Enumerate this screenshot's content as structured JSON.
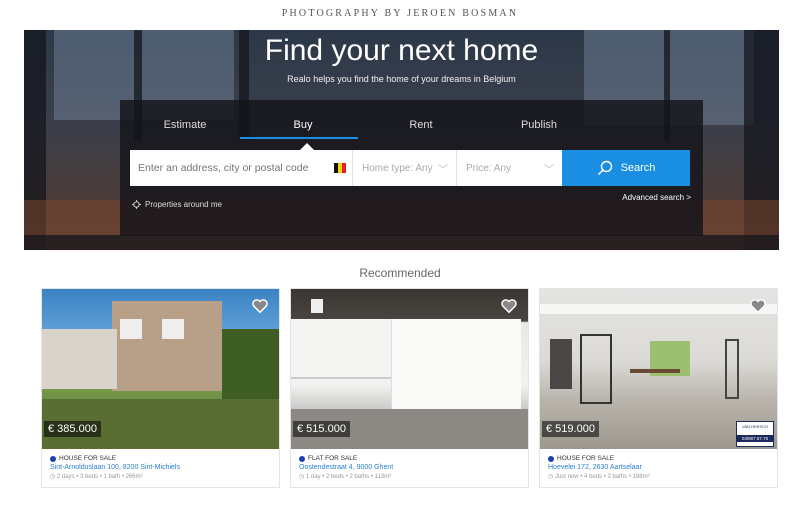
{
  "credit": "PHOTOGRAPHY BY JEROEN BOSMAN",
  "hero": {
    "title": "Find your next home",
    "subtitle": "Realo helps you find the home of your dreams in Belgium"
  },
  "tabs": [
    {
      "label": "Estimate",
      "active": false
    },
    {
      "label": "Buy",
      "active": true
    },
    {
      "label": "Rent",
      "active": false
    },
    {
      "label": "Publish",
      "active": false
    }
  ],
  "search": {
    "placeholder": "Enter an address, city or postal code",
    "home_type": "Home type: Any",
    "price": "Price: Any",
    "button": "Search",
    "around_me": "Properties around me",
    "advanced": "Advanced search >"
  },
  "recommended": {
    "title": "Recommended",
    "cards": [
      {
        "price": "€ 385.000",
        "type": "HOUSE FOR SALE",
        "address": "Sint-Arnolduslaan 100, 8200 Sint-Michiels",
        "meta": "◷ 2 days • 3 beds • 1 bath • 266m²"
      },
      {
        "price": "€ 515.000",
        "type": "FLAT FOR SALE",
        "address": "Oostendestraat 4, 9000 Ghent",
        "meta": "◷ 1 day • 2 beds • 2 baths • 113m²"
      },
      {
        "price": "€ 519.000",
        "type": "HOUSE FOR SALE",
        "address": "Hoevelei 172, 2630 Aartselaar",
        "meta": "◷ Just now • 4 beds • 2 baths • 198m²",
        "agency_top": "VAN HEESCH",
        "agency_phone": "03/887.87.76"
      }
    ]
  },
  "colors": {
    "accent": "#1a8ee0",
    "type_dot": "#1a3fb5",
    "link": "#2a7fd0"
  }
}
